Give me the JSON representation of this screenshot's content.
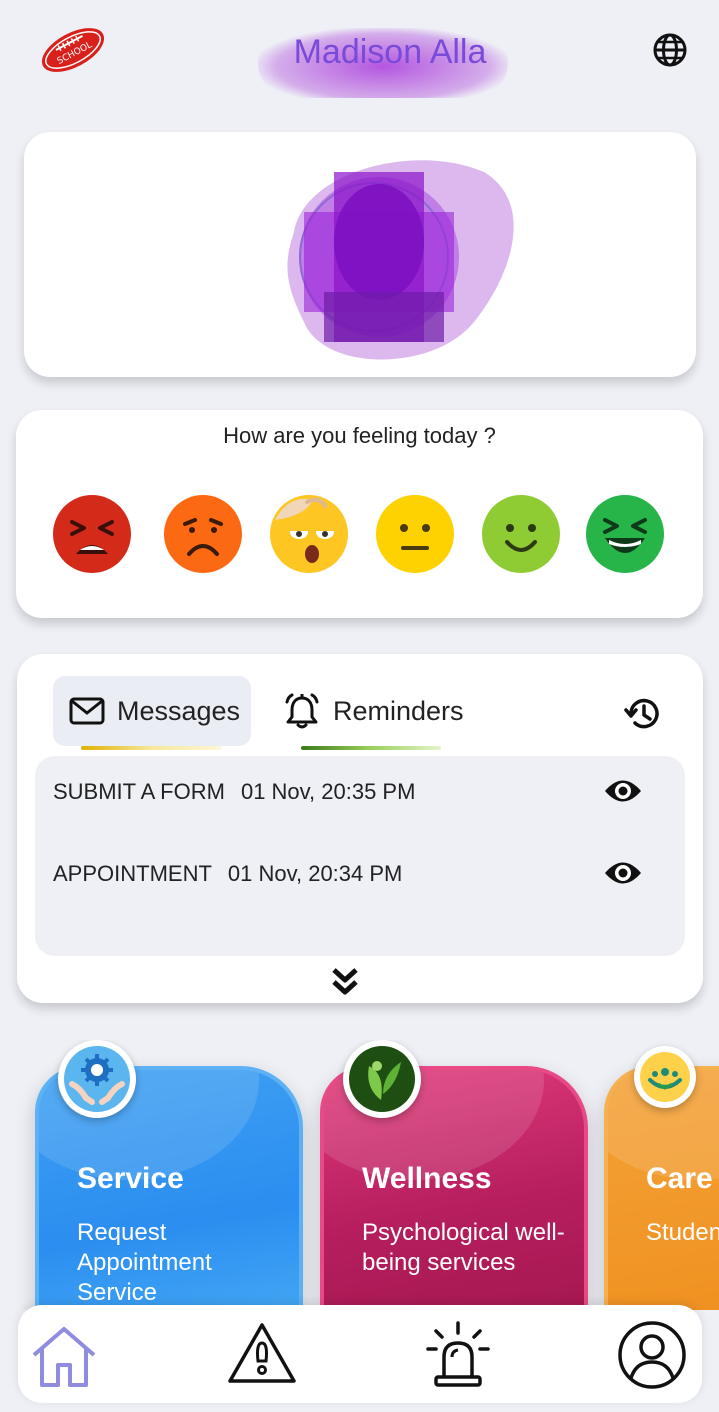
{
  "header": {
    "logo_text": "SCHOOL",
    "user_name": "Madison Alla"
  },
  "mood": {
    "question": "How are you feeling today ?",
    "options": [
      "very-angry",
      "sad",
      "tired",
      "neutral",
      "happy",
      "very-happy"
    ]
  },
  "messages": {
    "tabs": {
      "messages": "Messages",
      "reminders": "Reminders"
    },
    "items": [
      {
        "title": "SUBMIT A FORM",
        "time": "01 Nov, 20:35 PM"
      },
      {
        "title": "APPOINTMENT",
        "time": "01 Nov, 20:34 PM"
      }
    ]
  },
  "services": [
    {
      "title": "Service",
      "desc": "Request Appointment Service",
      "color": "#2b8ef0"
    },
    {
      "title": "Wellness",
      "desc": "Psychological well-being services",
      "color": "#b61e5e"
    },
    {
      "title": "Care",
      "desc": "Student team",
      "color": "#ef8f1e"
    }
  ],
  "nav": [
    "home-icon",
    "alert-icon",
    "siren-icon",
    "profile-icon"
  ]
}
